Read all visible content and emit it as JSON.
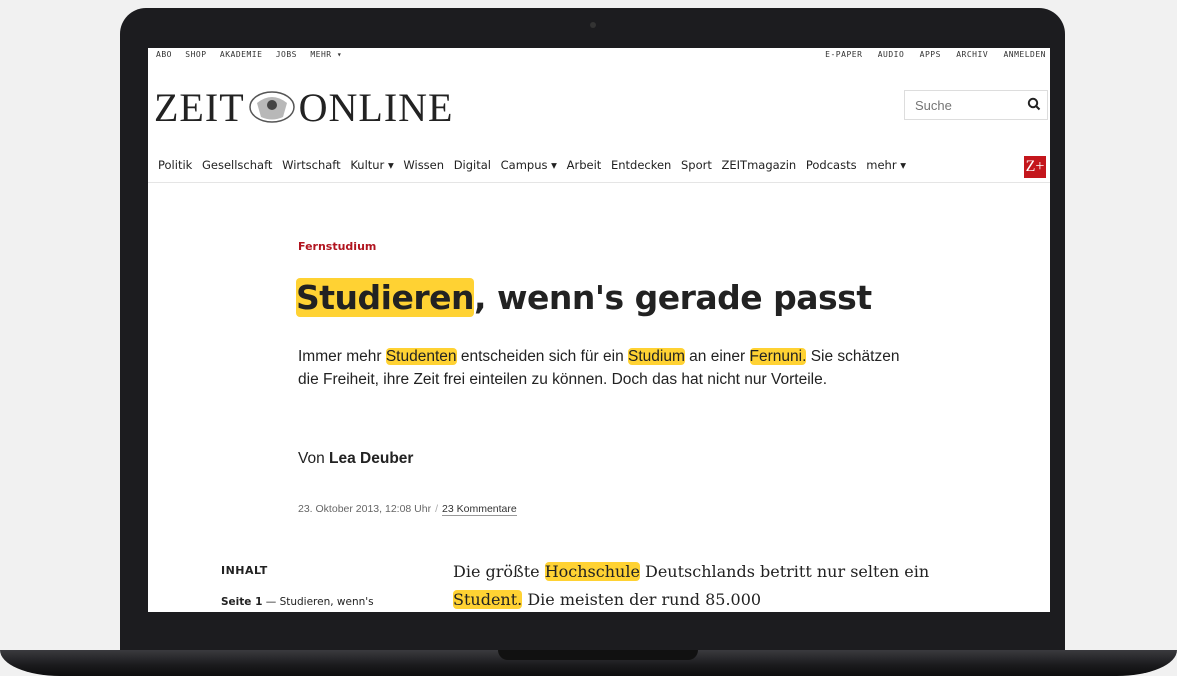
{
  "topbar": {
    "left": [
      "ABO",
      "SHOP",
      "AKADEMIE",
      "JOBS",
      "MEHR ▾"
    ],
    "right": [
      "E-PAPER",
      "AUDIO",
      "APPS",
      "ARCHIV",
      "ANMELDEN"
    ]
  },
  "logo": {
    "left": "ZEIT",
    "right": "ONLINE"
  },
  "search": {
    "placeholder": "Suche"
  },
  "nav": {
    "items": [
      "Politik",
      "Gesellschaft",
      "Wirtschaft",
      "Kultur ▾",
      "Wissen",
      "Digital",
      "Campus ▾",
      "Arbeit",
      "Entdecken",
      "Sport",
      "ZEITmagazin",
      "Podcasts",
      "mehr ▾"
    ],
    "zplus": "Z+"
  },
  "article": {
    "kicker": "Fernstudium",
    "headline_highlight": "Studieren",
    "headline_rest": ", wenn's gerade passt",
    "lead": {
      "p1": "Immer mehr ",
      "h1": "Studenten",
      "p2": " entscheiden sich für ein ",
      "h2": "Studium",
      "p3": " an einer ",
      "h3": "Fernuni.",
      "p4": " Sie schätzen die Freiheit, ihre Zeit frei einteilen zu können. Doch das hat nicht nur Vorteile."
    },
    "author_prefix": "Von ",
    "author_name": "Lea Deuber",
    "date": "23. Oktober 2013, 12:08 Uhr",
    "separator": "/",
    "comments": "23 Kommentare",
    "body": {
      "p1": "Die größte ",
      "h1": "Hochschule",
      "p2": " Deutschlands betritt nur selten ein ",
      "h2": "Student.",
      "p3": " Die meisten der rund 85.000"
    }
  },
  "toc": {
    "title": "INHALT",
    "item_page": "Seite 1",
    "item_text": " — Studieren, wenn's"
  },
  "colors": {
    "highlight": "#ffd233",
    "kicker": "#b1141f",
    "zplus": "#c4161c"
  }
}
